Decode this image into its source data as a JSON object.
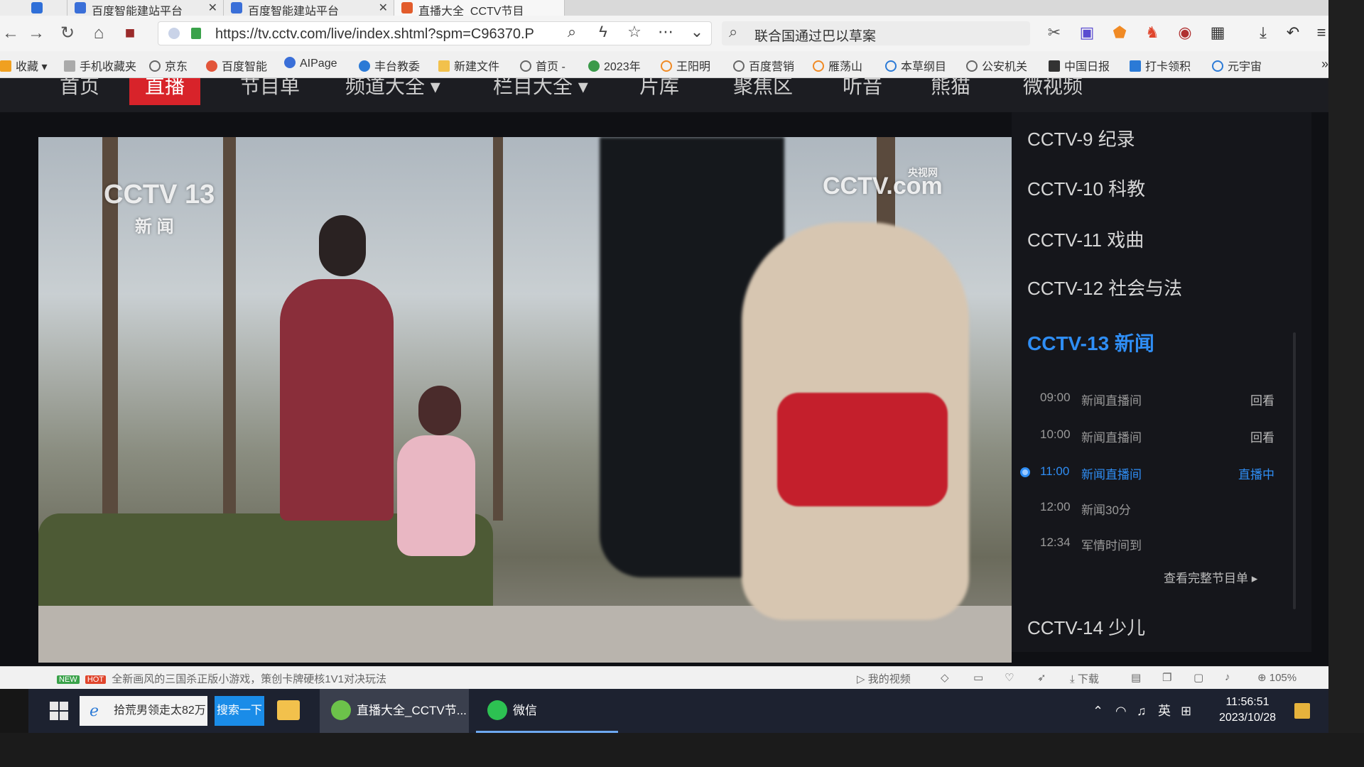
{
  "browser": {
    "tabs": [
      {
        "title": "百度智能建站平台"
      },
      {
        "title": "百度智能建站平台"
      },
      {
        "title": "直播大全_CCTV节目"
      }
    ],
    "address": {
      "url": "https://tv.cctv.com/live/index.shtml?spm=C96370.P"
    },
    "search": {
      "query": "联合国通过巴以草案"
    },
    "icons": {
      "back": "back-arrow-icon",
      "forward": "forward-arrow-icon",
      "reload": "reload-icon",
      "home": "home-icon",
      "zoom": "zoom-icon",
      "bolt": "bolt-icon",
      "star": "star-icon",
      "more": "more-icon",
      "chevron": "chevron-down-icon",
      "download": "download-icon",
      "undo": "undo-icon",
      "menu": "menu-icon"
    }
  },
  "bookmarks": {
    "items": [
      "收藏",
      "手机收藏夹",
      "京东",
      "百度智能",
      "AIPage",
      "丰台教委",
      "新建文件",
      "首页 -",
      "2023年",
      "王阳明",
      "百度营销",
      "雁荡山",
      "本草纲目",
      "公安机关",
      "中国日报",
      "打卡领积",
      "元宇宙"
    ]
  },
  "site_nav": {
    "items": [
      "首页",
      "直播",
      "节目单",
      "频道大全 ▾",
      "栏目大全 ▾",
      "片库",
      "聚焦区",
      "听音",
      "熊猫",
      "微视频"
    ],
    "active_index": 1
  },
  "player": {
    "channel_logo_top": "CCTV 13",
    "channel_logo_bottom": "新 闻",
    "site_logo": "CCTV.com",
    "site_logo_small": "央视网"
  },
  "channels": {
    "list_top": [
      "CCTV-9 纪录",
      "CCTV-10 科教",
      "CCTV-11 戏曲",
      "CCTV-12 社会与法"
    ],
    "active": "CCTV-13 新闻",
    "schedule": [
      {
        "time": "09:00",
        "title": "新闻直播间",
        "action": "回看",
        "live": false
      },
      {
        "time": "10:00",
        "title": "新闻直播间",
        "action": "回看",
        "live": false
      },
      {
        "time": "11:00",
        "title": "新闻直播间",
        "action": "直播中",
        "live": true
      },
      {
        "time": "12:00",
        "title": "新闻30分",
        "action": "",
        "live": false
      },
      {
        "time": "12:34",
        "title": "军情时间到",
        "action": "",
        "live": false
      }
    ],
    "full_guide": "查看完整节目单 ▸",
    "list_bottom": "CCTV-14 少儿",
    "accent_color": "#2f8ef5"
  },
  "statusbar": {
    "badge_new": "NEW",
    "badge_hot": "HOT",
    "news": "全新画风的三国杀正版小游戏，策创卡牌硬核1V1对决玩法",
    "my_video": "我的视频",
    "download": "下载",
    "zoom": "105%"
  },
  "taskbar": {
    "search_text": "拾荒男领走太82万",
    "search_button": "搜索一下",
    "app1": "直播大全_CCTV节...",
    "app2": "微信",
    "ime": "英",
    "time": "11:56:51",
    "date": "2023/10/28"
  }
}
